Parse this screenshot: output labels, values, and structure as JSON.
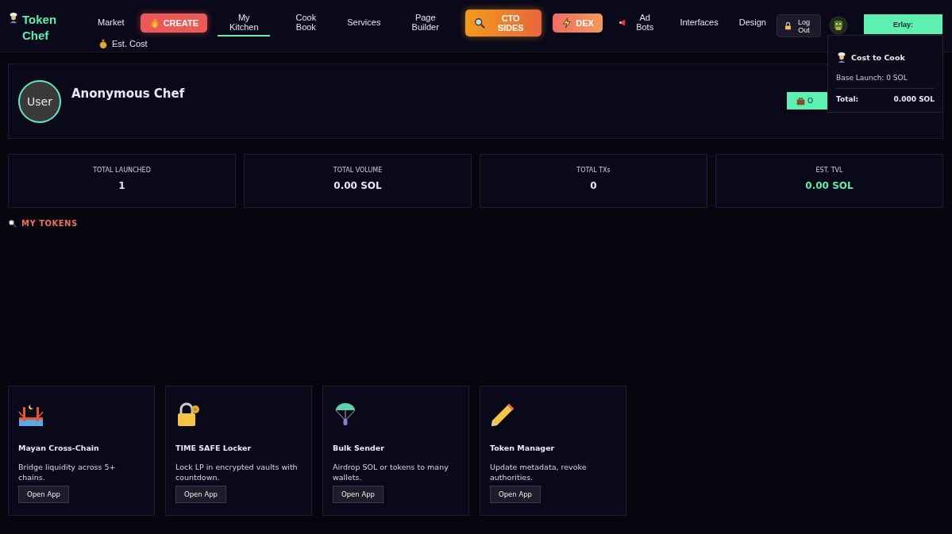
{
  "logo": {
    "text": "Token Chef"
  },
  "nav": [
    {
      "label": "Market",
      "kind": "link",
      "selected": false
    },
    {
      "label": "CREATE",
      "kind": "create",
      "selected": false
    },
    {
      "label": "My Kitchen",
      "kind": "link",
      "selected": true
    },
    {
      "label": "Cook Book",
      "kind": "link",
      "selected": false
    },
    {
      "label": "Services",
      "kind": "link",
      "selected": false
    },
    {
      "label": "Page Builder",
      "kind": "link",
      "selected": false
    },
    {
      "label": "CTO SIDES",
      "kind": "cto",
      "selected": false
    },
    {
      "label": "DEX",
      "kind": "dex",
      "selected": false
    },
    {
      "label": "Ad Bots",
      "kind": "adbots",
      "selected": false
    },
    {
      "label": "Interfaces",
      "kind": "link",
      "selected": false
    },
    {
      "label": "Design",
      "kind": "link",
      "selected": false
    },
    {
      "label": "Est. Cost",
      "kind": "cost",
      "selected": false
    }
  ],
  "logout": {
    "label": "Log Out"
  },
  "wallet": {
    "label": "Erlay:"
  },
  "cost_popup": {
    "title": "Cost to Cook",
    "base": "Base Launch: 0 SOL",
    "total_label": "Total:",
    "total_value": "0.000 SOL"
  },
  "profile": {
    "avatar": "User",
    "name": "Anonymous Chef",
    "button": "O"
  },
  "stats": [
    {
      "label": "TOTAL LAUNCHED",
      "value": "1",
      "highlight": false
    },
    {
      "label": "TOTAL VOLUME",
      "value": "0.00 SOL",
      "highlight": false
    },
    {
      "label": "TOTAL TXs",
      "value": "0",
      "highlight": false
    },
    {
      "label": "EST. TVL",
      "value": "0.00 SOL",
      "highlight": true
    }
  ],
  "section_title": "MY TOKENS",
  "tools": [
    {
      "kind": "bridge",
      "title": "Mayan Cross-Chain",
      "description": "Bridge liquidity across 5+ chains.",
      "button": "Open App"
    },
    {
      "kind": "lock",
      "title": "TIME SAFE Locker",
      "description": "Lock LP in encrypted vaults with countdown.",
      "button": "Open App"
    },
    {
      "kind": "parachute",
      "title": "Bulk Sender",
      "description": "Airdrop SOL or tokens to many wallets.",
      "button": "Open App"
    },
    {
      "kind": "pencil",
      "title": "Token Manager",
      "description": "Update metadata, revoke authorities.",
      "button": "Open App"
    }
  ]
}
